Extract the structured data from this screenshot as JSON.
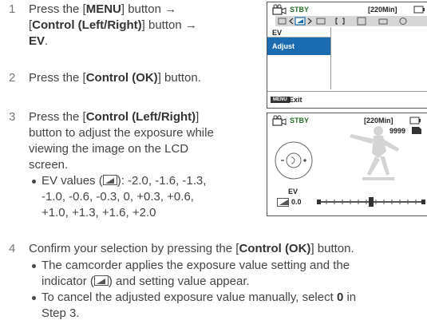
{
  "steps": [
    {
      "number": "1",
      "parts": [
        "Press the [",
        "MENU",
        "] button →",
        "[",
        "Control (Left/Right)",
        "] button →",
        "EV",
        "."
      ]
    },
    {
      "number": "2",
      "parts": [
        "Press the [",
        "Control (OK)",
        "] button."
      ]
    },
    {
      "number": "3",
      "parts": [
        "Press the [",
        "Control (Left/Right)",
        "]",
        "button to adjust the exposure while",
        "viewing the image on the LCD",
        "screen."
      ],
      "bullets": [
        [
          "EV values (",
          "): -2.0, -1.6, -1.3,",
          "-1.0, -0.6, -0.3, 0, +0.3, +0.6,",
          "+1.0, +1.3, +1.6, +2.0"
        ]
      ]
    },
    {
      "number": "4",
      "parts": [
        "Confirm your selection by pressing the [",
        "Control (OK)",
        "] button."
      ],
      "bullets": [
        [
          "The camcorder applies the exposure value setting and the",
          "indicator (",
          ") and setting value appear."
        ],
        [
          "To cancel the adjusted exposure value manually, select ",
          "0",
          " in",
          "Step 3."
        ]
      ]
    }
  ],
  "screen1": {
    "status": "STBY",
    "time": "[220Min]",
    "menu_ev": "EV",
    "menu_adjust": "Adjust",
    "exit_key": "MENU",
    "exit_label": "Exit"
  },
  "screen2": {
    "status": "STBY",
    "time": "[220Min]",
    "count": "9999",
    "ev_label": "EV",
    "ev_value": "0.0"
  },
  "colors": {
    "menu_highlight": "#1b6bb0",
    "screen_border": "#555555"
  },
  "icons": [
    "camcorder-icon",
    "battery-icon",
    "ev-icon",
    "dial-icon",
    "memory-card-icon"
  ]
}
